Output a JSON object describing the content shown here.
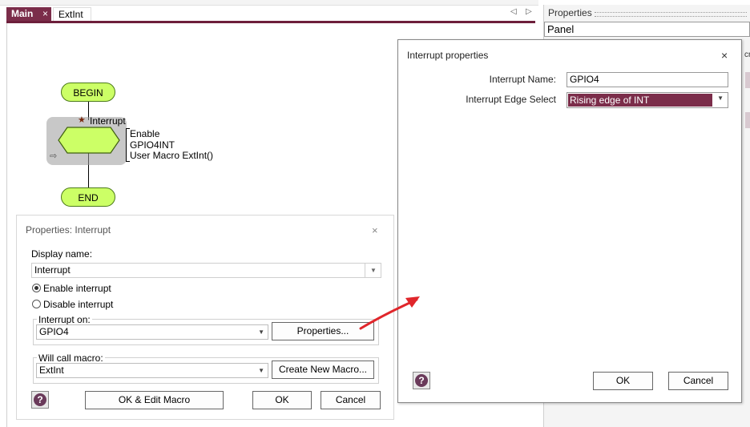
{
  "tabs": [
    {
      "label": "Main",
      "close_glyph": "×",
      "active": true
    },
    {
      "label": "ExtInt",
      "active": false
    }
  ],
  "tab_nav": {
    "left": "◁",
    "right": "▷"
  },
  "properties_panel": {
    "title": "Properties",
    "selector_value": "Panel",
    "edge_text": "cr"
  },
  "flowchart": {
    "begin_label": "BEGIN",
    "end_label": "END",
    "interrupt_label": "Interrupt",
    "interrupt_star": "★",
    "interrupt_arrow": "⇨",
    "interrupt_details": [
      "Enable",
      "GPIO4INT",
      "User Macro ExtInt()"
    ],
    "colors": {
      "terminal_fill": "#ccff66",
      "shadow": "#9a9a9a"
    }
  },
  "props_interrupt_dialog": {
    "title": "Properties: Interrupt",
    "close_glyph": "×",
    "display_name_label": "Display name:",
    "display_name_value": "Interrupt",
    "enable_label": "Enable interrupt",
    "disable_label": "Disable interrupt",
    "enable_selected": true,
    "interrupt_on_label": "Interrupt on:",
    "interrupt_on_value": "GPIO4",
    "properties_button": "Properties...",
    "will_call_label": "Will call macro:",
    "will_call_value": "ExtInt",
    "create_macro_button": "Create New Macro...",
    "ok_edit_button": "OK & Edit Macro",
    "ok_button": "OK",
    "cancel_button": "Cancel",
    "help_glyph": "?"
  },
  "interrupt_properties_dialog": {
    "title": "Interrupt properties",
    "close_glyph": "×",
    "name_label": "Interrupt Name:",
    "name_value": "GPIO4",
    "edge_label": "Interrupt Edge Select",
    "edge_value": "Rising edge of INT",
    "ok_button": "OK",
    "cancel_button": "Cancel",
    "help_glyph": "?",
    "selection_color": "#7b2d4a"
  },
  "dropdown_glyph": "▼",
  "accent_color": "#7b2d4a",
  "annotation_arrow_color": "#e0262b"
}
